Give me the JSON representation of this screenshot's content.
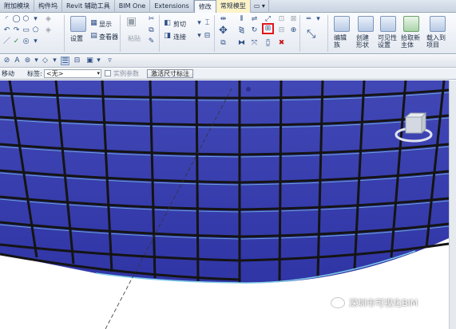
{
  "tabs": [
    "附加模块",
    "构件坞",
    "Revit 辅助工具",
    "BIM One",
    "Extensions",
    "修改",
    "常规模型",
    "▭ ▾"
  ],
  "ribbon": {
    "settings_label": "设置",
    "show_label": "显示",
    "viewer_label": "查看器",
    "paste_label": "粘贴",
    "cut_label": "剪切",
    "join_label": "连接",
    "edit_label": "编辑族",
    "create_label": "创建形状",
    "visibility_label": "可见性设置",
    "pick_host_label": "拾取新主体",
    "load_project_label": "载入到项目"
  },
  "options_bar": {
    "mode_label": "移动",
    "tag_label": "标签:",
    "tag_value": "<无>",
    "instance_param_label": "实例参数",
    "activate_dim_label": "激活尺寸标注"
  },
  "canvas": {
    "curtain_color": "#3a3fae",
    "mullion_color": "#1a1a1a",
    "accent_line_color": "#7ecbe8",
    "background": "#ffffff"
  },
  "watermark": {
    "text": "深圳市可视化BIM"
  },
  "icons": {
    "highlighted_tool": "align-grid-icon"
  }
}
